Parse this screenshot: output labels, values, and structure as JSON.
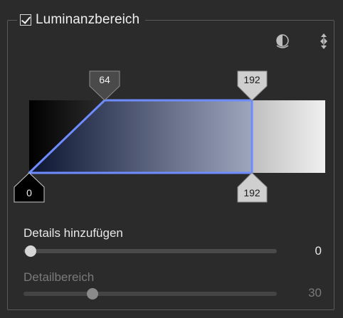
{
  "panel": {
    "enabled": true,
    "title": "Luminanzbereich"
  },
  "toolbar": {
    "icons": [
      "tone-mask-icon",
      "move-arrows-icon"
    ]
  },
  "range": {
    "markers": {
      "top_left": "64",
      "top_right": "192",
      "bottom_left": "0",
      "bottom_right": "192"
    },
    "colors": {
      "accent": "#6f8cff",
      "fill_dark": "#0b1430",
      "fill_light": "#9ea6be"
    }
  },
  "sliders": [
    {
      "label": "Details hinzufügen",
      "value": "0",
      "level": 0,
      "enabled": true
    },
    {
      "label": "Detailbereich",
      "value": "30",
      "level": 0.26,
      "enabled": false
    }
  ]
}
